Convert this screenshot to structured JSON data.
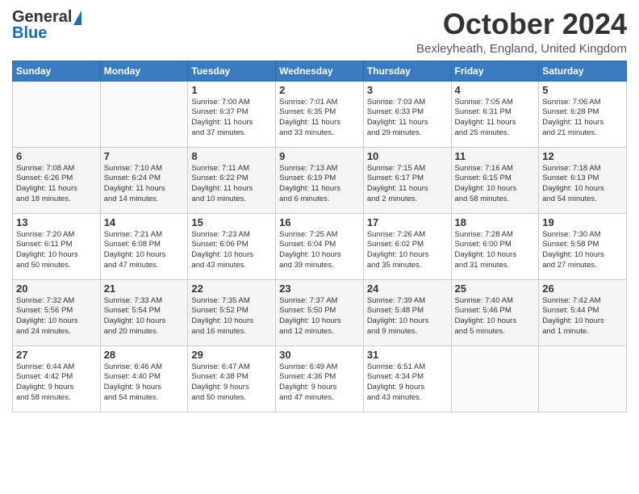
{
  "logo": {
    "line1": "General",
    "line2": "Blue"
  },
  "header": {
    "month": "October 2024",
    "location": "Bexleyheath, England, United Kingdom"
  },
  "weekdays": [
    "Sunday",
    "Monday",
    "Tuesday",
    "Wednesday",
    "Thursday",
    "Friday",
    "Saturday"
  ],
  "weeks": [
    [
      {
        "day": "",
        "info": ""
      },
      {
        "day": "",
        "info": ""
      },
      {
        "day": "1",
        "info": "Sunrise: 7:00 AM\nSunset: 6:37 PM\nDaylight: 11 hours\nand 37 minutes."
      },
      {
        "day": "2",
        "info": "Sunrise: 7:01 AM\nSunset: 6:35 PM\nDaylight: 11 hours\nand 33 minutes."
      },
      {
        "day": "3",
        "info": "Sunrise: 7:03 AM\nSunset: 6:33 PM\nDaylight: 11 hours\nand 29 minutes."
      },
      {
        "day": "4",
        "info": "Sunrise: 7:05 AM\nSunset: 6:31 PM\nDaylight: 11 hours\nand 25 minutes."
      },
      {
        "day": "5",
        "info": "Sunrise: 7:06 AM\nSunset: 6:28 PM\nDaylight: 11 hours\nand 21 minutes."
      }
    ],
    [
      {
        "day": "6",
        "info": "Sunrise: 7:08 AM\nSunset: 6:26 PM\nDaylight: 11 hours\nand 18 minutes."
      },
      {
        "day": "7",
        "info": "Sunrise: 7:10 AM\nSunset: 6:24 PM\nDaylight: 11 hours\nand 14 minutes."
      },
      {
        "day": "8",
        "info": "Sunrise: 7:11 AM\nSunset: 6:22 PM\nDaylight: 11 hours\nand 10 minutes."
      },
      {
        "day": "9",
        "info": "Sunrise: 7:13 AM\nSunset: 6:19 PM\nDaylight: 11 hours\nand 6 minutes."
      },
      {
        "day": "10",
        "info": "Sunrise: 7:15 AM\nSunset: 6:17 PM\nDaylight: 11 hours\nand 2 minutes."
      },
      {
        "day": "11",
        "info": "Sunrise: 7:16 AM\nSunset: 6:15 PM\nDaylight: 10 hours\nand 58 minutes."
      },
      {
        "day": "12",
        "info": "Sunrise: 7:18 AM\nSunset: 6:13 PM\nDaylight: 10 hours\nand 54 minutes."
      }
    ],
    [
      {
        "day": "13",
        "info": "Sunrise: 7:20 AM\nSunset: 6:11 PM\nDaylight: 10 hours\nand 50 minutes."
      },
      {
        "day": "14",
        "info": "Sunrise: 7:21 AM\nSunset: 6:08 PM\nDaylight: 10 hours\nand 47 minutes."
      },
      {
        "day": "15",
        "info": "Sunrise: 7:23 AM\nSunset: 6:06 PM\nDaylight: 10 hours\nand 43 minutes."
      },
      {
        "day": "16",
        "info": "Sunrise: 7:25 AM\nSunset: 6:04 PM\nDaylight: 10 hours\nand 39 minutes."
      },
      {
        "day": "17",
        "info": "Sunrise: 7:26 AM\nSunset: 6:02 PM\nDaylight: 10 hours\nand 35 minutes."
      },
      {
        "day": "18",
        "info": "Sunrise: 7:28 AM\nSunset: 6:00 PM\nDaylight: 10 hours\nand 31 minutes."
      },
      {
        "day": "19",
        "info": "Sunrise: 7:30 AM\nSunset: 5:58 PM\nDaylight: 10 hours\nand 27 minutes."
      }
    ],
    [
      {
        "day": "20",
        "info": "Sunrise: 7:32 AM\nSunset: 5:56 PM\nDaylight: 10 hours\nand 24 minutes."
      },
      {
        "day": "21",
        "info": "Sunrise: 7:33 AM\nSunset: 5:54 PM\nDaylight: 10 hours\nand 20 minutes."
      },
      {
        "day": "22",
        "info": "Sunrise: 7:35 AM\nSunset: 5:52 PM\nDaylight: 10 hours\nand 16 minutes."
      },
      {
        "day": "23",
        "info": "Sunrise: 7:37 AM\nSunset: 5:50 PM\nDaylight: 10 hours\nand 12 minutes."
      },
      {
        "day": "24",
        "info": "Sunrise: 7:39 AM\nSunset: 5:48 PM\nDaylight: 10 hours\nand 9 minutes."
      },
      {
        "day": "25",
        "info": "Sunrise: 7:40 AM\nSunset: 5:46 PM\nDaylight: 10 hours\nand 5 minutes."
      },
      {
        "day": "26",
        "info": "Sunrise: 7:42 AM\nSunset: 5:44 PM\nDaylight: 10 hours\nand 1 minute."
      }
    ],
    [
      {
        "day": "27",
        "info": "Sunrise: 6:44 AM\nSunset: 4:42 PM\nDaylight: 9 hours\nand 58 minutes."
      },
      {
        "day": "28",
        "info": "Sunrise: 6:46 AM\nSunset: 4:40 PM\nDaylight: 9 hours\nand 54 minutes."
      },
      {
        "day": "29",
        "info": "Sunrise: 6:47 AM\nSunset: 4:38 PM\nDaylight: 9 hours\nand 50 minutes."
      },
      {
        "day": "30",
        "info": "Sunrise: 6:49 AM\nSunset: 4:36 PM\nDaylight: 9 hours\nand 47 minutes."
      },
      {
        "day": "31",
        "info": "Sunrise: 6:51 AM\nSunset: 4:34 PM\nDaylight: 9 hours\nand 43 minutes."
      },
      {
        "day": "",
        "info": ""
      },
      {
        "day": "",
        "info": ""
      }
    ]
  ]
}
